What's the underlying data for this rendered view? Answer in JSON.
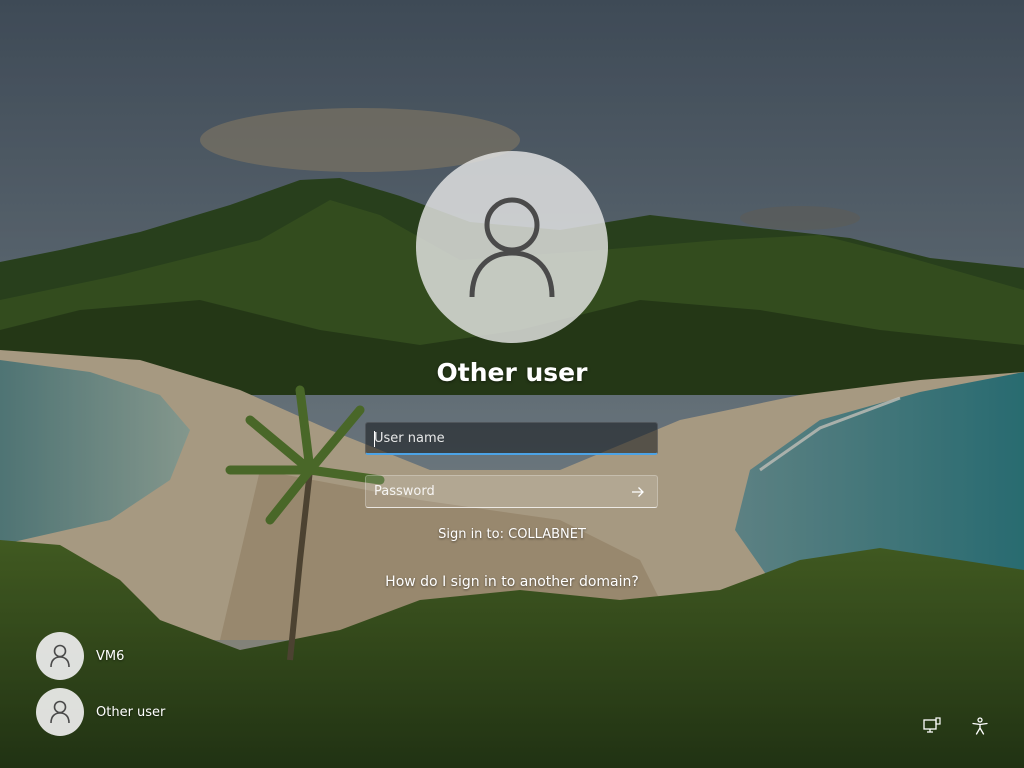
{
  "login": {
    "user_title": "Other user",
    "username_placeholder": "User name",
    "password_placeholder": "Password",
    "sign_in_to": "Sign in to: COLLABNET",
    "domain_help_link": "How do I sign in to another domain?",
    "submit_icon": "arrow-right-icon"
  },
  "users": [
    {
      "label": "VM6",
      "icon": "user-icon"
    },
    {
      "label": "Other user",
      "icon": "user-icon"
    }
  ],
  "corner_icons": {
    "network": "network-icon",
    "accessibility": "accessibility-icon"
  },
  "colors": {
    "focus_accent": "#4ca3e6",
    "text": "#ffffff"
  }
}
